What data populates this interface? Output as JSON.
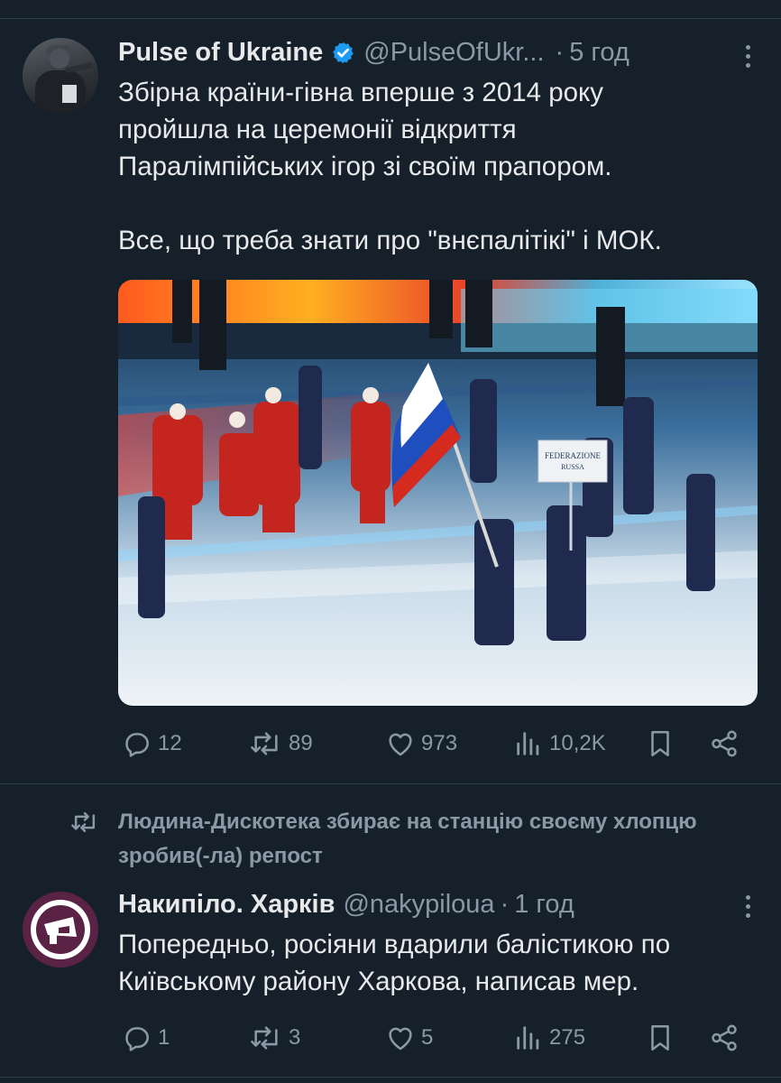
{
  "tweets": [
    {
      "name": "Pulse of Ukraine",
      "handle": "@PulseOfUkr...",
      "time": "5 год",
      "text": [
        "Збірна країни-гівна вперше з 2014 року",
        "пройшла на церемонії відкриття",
        "Паралімпійських ігор зі своїм прапором.",
        "",
        "Все, що треба знати про \"внєпалітікі\" і МОК."
      ],
      "sign_text": [
        "FEDERAZIONE",
        "RUSSA"
      ],
      "stats": {
        "replies": "12",
        "reposts": "89",
        "likes": "973",
        "views": "10,2K"
      }
    },
    {
      "repost_label": "Людина-Дискотека збирає на станцію своєму хлопцю зробив(-ла) репост",
      "name": "Накипіло. Харків",
      "handle": "@nakypiloua",
      "time": "1 год",
      "text": [
        "Попередньо, росіяни вдарили балістикою по",
        "Київському району Харкова, написав мер."
      ],
      "stats": {
        "replies": "1",
        "reposts": "3",
        "likes": "5",
        "views": "275"
      }
    }
  ],
  "colors": {
    "background": "#16202b",
    "text": "#e7e9ea",
    "muted": "#8b98a5",
    "verified": "#1d9bf0",
    "logo_bg": "#5a2245"
  },
  "icons": [
    "verified-badge-icon",
    "more-icon",
    "reply-icon",
    "repost-icon",
    "like-icon",
    "views-icon",
    "bookmark-icon",
    "share-icon"
  ]
}
